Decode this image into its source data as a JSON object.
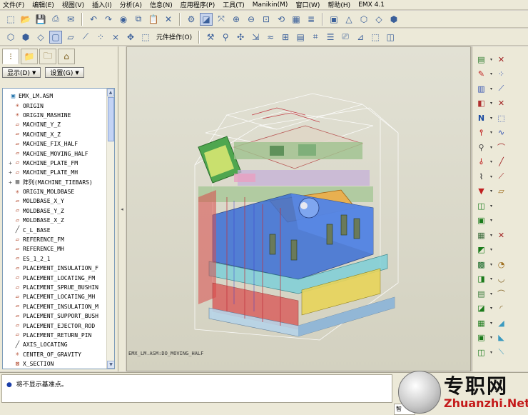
{
  "menu": [
    "文件(F)",
    "编辑(E)",
    "视图(V)",
    "插入(I)",
    "分析(A)",
    "信息(N)",
    "应用程序(P)",
    "工具(T)",
    "Manikin(M)",
    "窗口(W)",
    "帮助(H)",
    "EMX 4.1"
  ],
  "toolbar": {
    "component_op_label": "元件操作(O)",
    "row1_icons": [
      "new-icon",
      "open-icon",
      "save-icon",
      "print-icon",
      "email-icon",
      "undo-icon",
      "redo-icon",
      "regenerate-icon",
      "copy-icon",
      "paste-icon",
      "delete-icon",
      "settings-icon",
      "datum-display-icon",
      "view-icon",
      "fit-icon",
      "zoom-in-icon",
      "zoom-out-icon",
      "refit-icon",
      "orient-icon",
      "saved-views-icon",
      "layers-icon",
      "shading-icon",
      "hidden-line-icon",
      "no-hidden-icon",
      "wireframe-icon"
    ],
    "row2_icons": [
      "model-tree-icon",
      "shaded-icon",
      "wireframe-icon",
      "hidden-icon",
      "plane-icon",
      "axis-icon",
      "point-icon",
      "csys-icon",
      "spin-center-icon"
    ]
  },
  "navigator": {
    "show_label": "显示(D)",
    "settings_label": "设置(G)"
  },
  "model_tree": [
    {
      "label": "EMX_LM.ASM",
      "icon": "assembly-icon",
      "expand": ""
    },
    {
      "label": "ORIGIN",
      "icon": "csys-icon",
      "expand": ""
    },
    {
      "label": "ORIGIN_MASHINE",
      "icon": "csys-icon",
      "expand": ""
    },
    {
      "label": "MACHINE_Y_Z",
      "icon": "datum-plane-icon",
      "expand": ""
    },
    {
      "label": "MACHINE_X_Z",
      "icon": "datum-plane-icon",
      "expand": ""
    },
    {
      "label": "MACHINE_FIX_HALF",
      "icon": "datum-plane-icon",
      "expand": ""
    },
    {
      "label": "MACHINE_MOVING_HALF",
      "icon": "datum-plane-icon",
      "expand": ""
    },
    {
      "label": "MACHINE_PLATE_FM",
      "icon": "datum-plane-icon",
      "expand": "+"
    },
    {
      "label": "MACHINE_PLATE_MH",
      "icon": "datum-plane-icon",
      "expand": "+"
    },
    {
      "label": "阵列(MACHINE_TIEBARS)",
      "icon": "pattern-icon",
      "expand": "+"
    },
    {
      "label": "ORIGIN_MOLDBASE",
      "icon": "csys-icon",
      "expand": ""
    },
    {
      "label": "MOLDBASE_X_Y",
      "icon": "datum-plane-icon",
      "expand": ""
    },
    {
      "label": "MOLDBASE_Y_Z",
      "icon": "datum-plane-icon",
      "expand": ""
    },
    {
      "label": "MOLDBASE_X_Z",
      "icon": "datum-plane-icon",
      "expand": ""
    },
    {
      "label": "C_L_BASE",
      "icon": "axis-icon",
      "expand": ""
    },
    {
      "label": "REFERENCE_FM",
      "icon": "datum-plane-icon",
      "expand": ""
    },
    {
      "label": "REFERENCE_MH",
      "icon": "datum-plane-icon",
      "expand": ""
    },
    {
      "label": "ES_1_2_1",
      "icon": "datum-plane-icon",
      "expand": ""
    },
    {
      "label": "PLACEMENT_INSULATION_F",
      "icon": "datum-plane-icon",
      "expand": ""
    },
    {
      "label": "PLACEMENT_LOCATING_FM",
      "icon": "datum-plane-icon",
      "expand": ""
    },
    {
      "label": "PLACEMENT_SPRUE_BUSHIN",
      "icon": "datum-plane-icon",
      "expand": ""
    },
    {
      "label": "PLACEMENT_LOCATING_MH",
      "icon": "datum-plane-icon",
      "expand": ""
    },
    {
      "label": "PLACEMENT_INSULATION_M",
      "icon": "datum-plane-icon",
      "expand": ""
    },
    {
      "label": "PLACEMENT_SUPPORT_BUSH",
      "icon": "datum-plane-icon",
      "expand": ""
    },
    {
      "label": "PLACEMENT_EJECTOR_ROD",
      "icon": "datum-plane-icon",
      "expand": ""
    },
    {
      "label": "PLACEMENT_RETURN_PIN",
      "icon": "datum-plane-icon",
      "expand": ""
    },
    {
      "label": "AXIS_LOCATING",
      "icon": "axis-icon",
      "expand": ""
    },
    {
      "label": "CENTER_OF_GRAVITY",
      "icon": "csys-icon",
      "expand": ""
    },
    {
      "label": "X_SECTION",
      "icon": "xsec-icon",
      "expand": ""
    }
  ],
  "viewport": {
    "model_label": "EMX_LM.ASM:DO_MOVING_HALF"
  },
  "status": {
    "message": "将不显示基准点。",
    "smart_box": "智"
  },
  "watermark": {
    "cn": "专职网",
    "en": "Zhuanzhi.Net"
  },
  "colors": {
    "plate_blue": "#3b6fd6",
    "plate_red": "#d94a4a",
    "plate_yellow": "#e8d45a",
    "plate_cyan": "#7ed0d8",
    "accent": "#3a5f9a"
  }
}
